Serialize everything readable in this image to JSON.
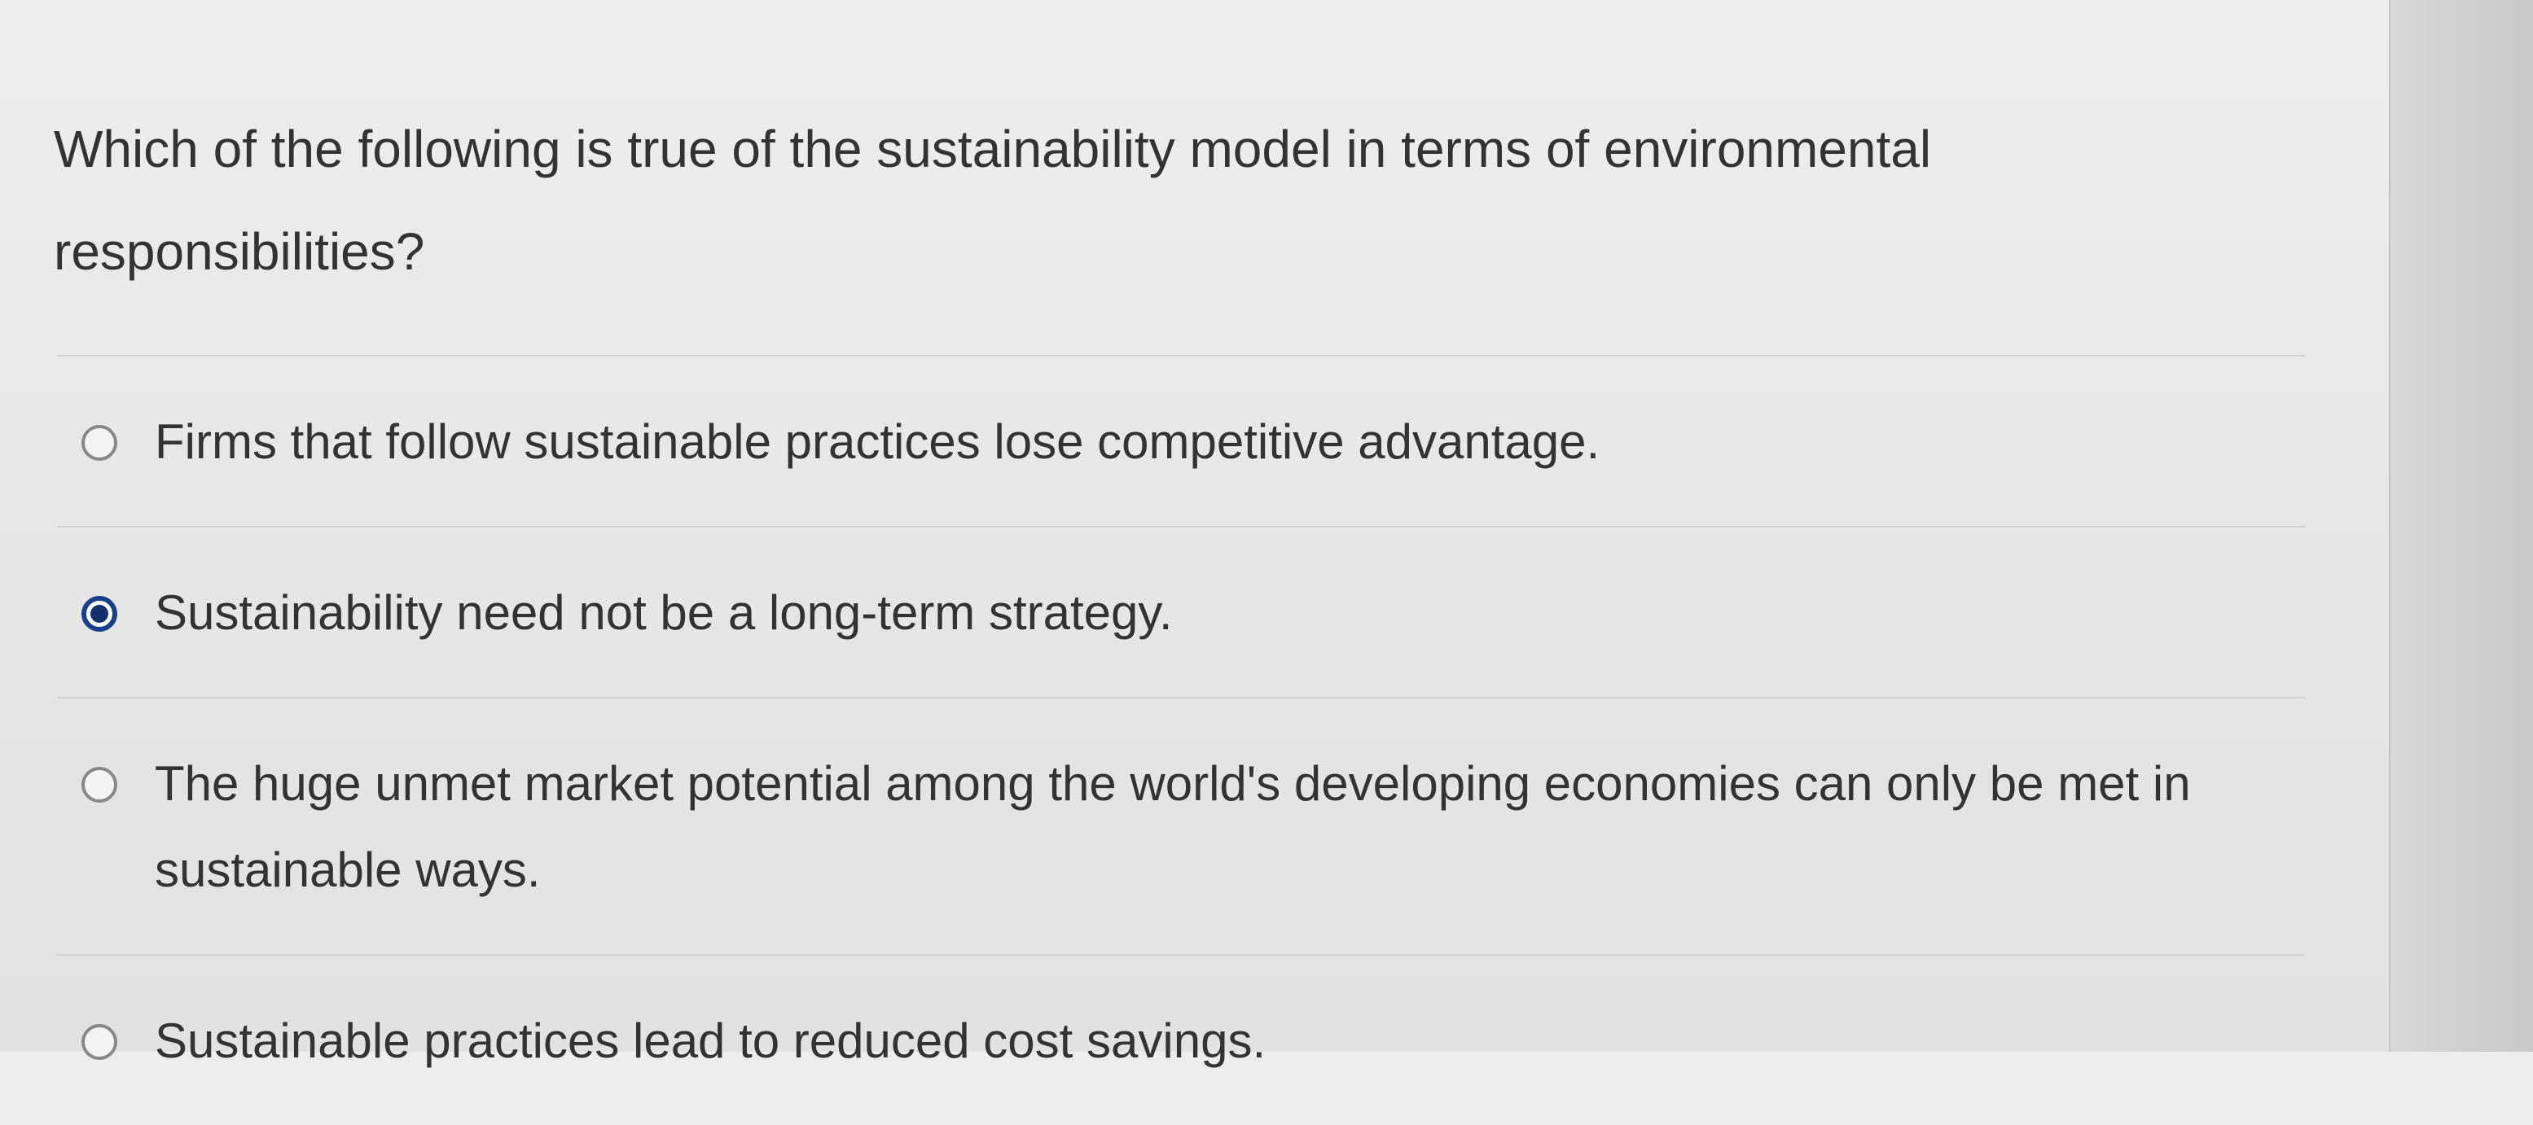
{
  "question": {
    "text": "Which of the following is true of the sustainability model in terms of environmental responsibilities?"
  },
  "options": [
    {
      "label": "Firms that follow sustainable practices lose competitive advantage.",
      "selected": false
    },
    {
      "label": "Sustainability need not be a long-term strategy.",
      "selected": true
    },
    {
      "label": "The huge unmet market potential among the world's developing economies can only be met in sustainable ways.",
      "selected": false
    },
    {
      "label": "Sustainable practices lead to reduced cost savings.",
      "selected": false
    }
  ],
  "colors": {
    "selected_radio": "#1a3f8a",
    "text": "#333333",
    "background": "#ededed"
  }
}
